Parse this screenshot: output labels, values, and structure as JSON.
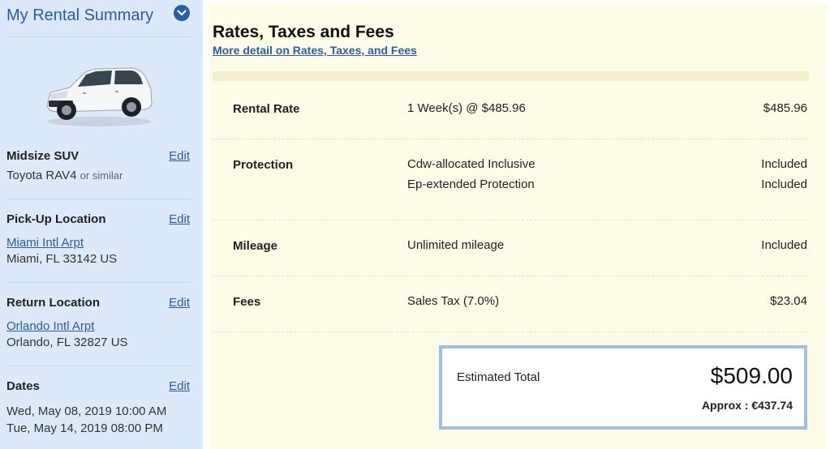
{
  "sidebar": {
    "title": "My Rental Summary",
    "vehicle": {
      "label": "Midsize SUV",
      "edit_label": "Edit",
      "model": "Toyota RAV4",
      "similar": "or similar"
    },
    "pickup": {
      "label": "Pick-Up Location",
      "edit_label": "Edit",
      "location_link": "Miami Intl Arpt",
      "address": "Miami, FL 33142 US"
    },
    "return": {
      "label": "Return Location",
      "edit_label": "Edit",
      "location_link": "Orlando Intl Arpt",
      "address": "Orlando, FL 32827 US"
    },
    "dates": {
      "label": "Dates",
      "edit_label": "Edit",
      "pickup": "Wed, May 08, 2019 10:00 AM",
      "return": "Tue, May 14, 2019 08:00 PM"
    }
  },
  "main": {
    "title": "Rates, Taxes and Fees",
    "detail_link": "More detail on Rates, Taxes, and Fees",
    "rows": [
      {
        "label": "Rental Rate",
        "items": [
          {
            "desc": "1 Week(s) @ $485.96",
            "amount": "$485.96"
          }
        ]
      },
      {
        "label": "Protection",
        "items": [
          {
            "desc": "Cdw-allocated Inclusive",
            "amount": "Included"
          },
          {
            "desc": "Ep-extended Protection",
            "amount": "Included"
          }
        ]
      },
      {
        "label": "Mileage",
        "items": [
          {
            "desc": "Unlimited mileage",
            "amount": "Included"
          }
        ]
      },
      {
        "label": "Fees",
        "items": [
          {
            "desc": "Sales Tax (7.0%)",
            "amount": "$23.04"
          }
        ]
      }
    ],
    "total": {
      "label": "Estimated Total",
      "amount": "$509.00",
      "approx": "Approx : €437.74"
    }
  },
  "colors": {
    "link": "#2a5ca8",
    "sidebar_bg": "#dce9fb",
    "main_bg": "#fdfce7",
    "total_border": "#9cc0e4"
  },
  "icons": {
    "toggle": "chevron-down-icon",
    "vehicle": "car-image"
  }
}
